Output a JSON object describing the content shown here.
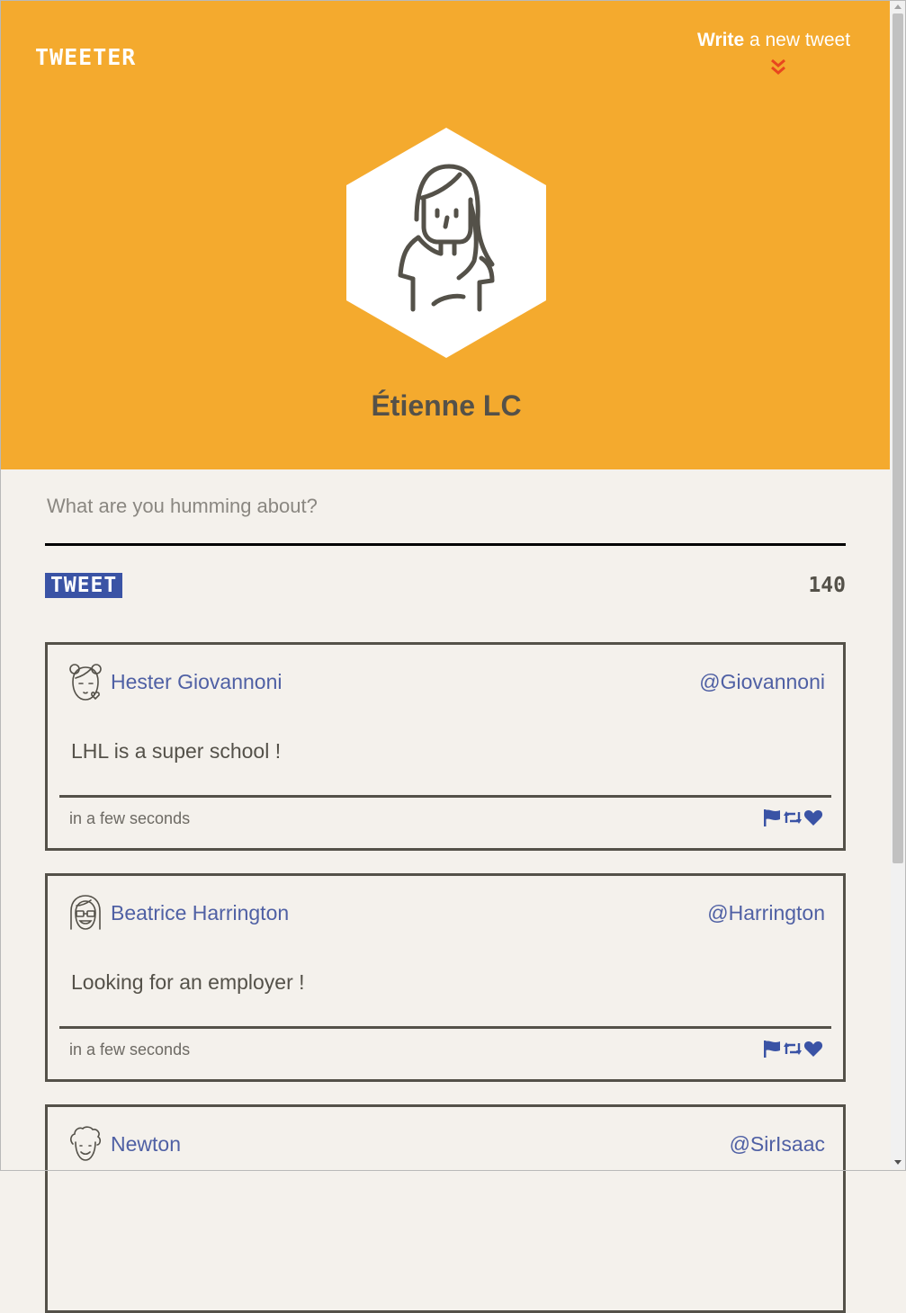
{
  "app": {
    "logo": "TWEETER"
  },
  "nav": {
    "compose_bold": "Write",
    "compose_rest": "a new tweet"
  },
  "profile": {
    "name": "Étienne LC"
  },
  "composer": {
    "placeholder": "What are you humming about?",
    "button_label": "TWEET",
    "char_count": "140"
  },
  "tweets": [
    {
      "name": "Hester Giovannoni",
      "handle": "@Giovannoni",
      "content": "LHL is a super school !",
      "time": "in a few seconds",
      "avatar_icon": "girl-buns-avatar-icon"
    },
    {
      "name": "Beatrice Harrington",
      "handle": "@Harrington",
      "content": "Looking for an employer !",
      "time": "in a few seconds",
      "avatar_icon": "girl-glasses-avatar-icon"
    },
    {
      "name": "Newton",
      "handle": "@SirIsaac",
      "content": "",
      "time": "",
      "avatar_icon": "curly-hair-man-avatar-icon"
    }
  ],
  "colors": {
    "header": "#f4aa2e",
    "background": "#f4f1ec",
    "accent_blue": "#3a53a5",
    "link_blue": "#4f60a4",
    "dark_text": "#545149",
    "chevron_red": "#e8461e"
  }
}
